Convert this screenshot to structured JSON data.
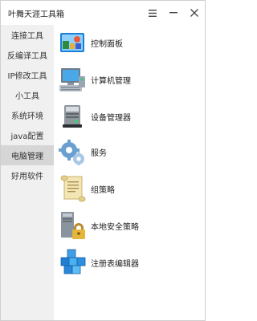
{
  "window": {
    "title": "叶舞天涯工具箱"
  },
  "titlebar": {
    "menu_icon": "hamburger-icon",
    "minimize_icon": "minimize-icon",
    "close_icon": "close-icon"
  },
  "sidebar": {
    "items": [
      {
        "label": "连接工具"
      },
      {
        "label": "反编译工具"
      },
      {
        "label": "IP修改工具"
      },
      {
        "label": "小工具"
      },
      {
        "label": "系统环境"
      },
      {
        "label": "java配置"
      },
      {
        "label": "电脑管理",
        "active": true
      },
      {
        "label": "好用软件"
      }
    ]
  },
  "tools": [
    {
      "label": "控制面板",
      "icon": "control-panel-icon"
    },
    {
      "label": "计算机管理",
      "icon": "computer-management-icon"
    },
    {
      "label": "设备管理器",
      "icon": "device-manager-icon"
    },
    {
      "label": "服务",
      "icon": "services-gears-icon"
    },
    {
      "label": "组策略",
      "icon": "group-policy-scroll-icon"
    },
    {
      "label": "本地安全策略",
      "icon": "local-security-policy-icon"
    },
    {
      "label": "注册表编辑器",
      "icon": "registry-editor-icon"
    }
  ],
  "colors": {
    "sidebar_bg": "#f0f0f0",
    "active_bg": "#d6d6d6",
    "accent_blue": "#1e88d8"
  }
}
